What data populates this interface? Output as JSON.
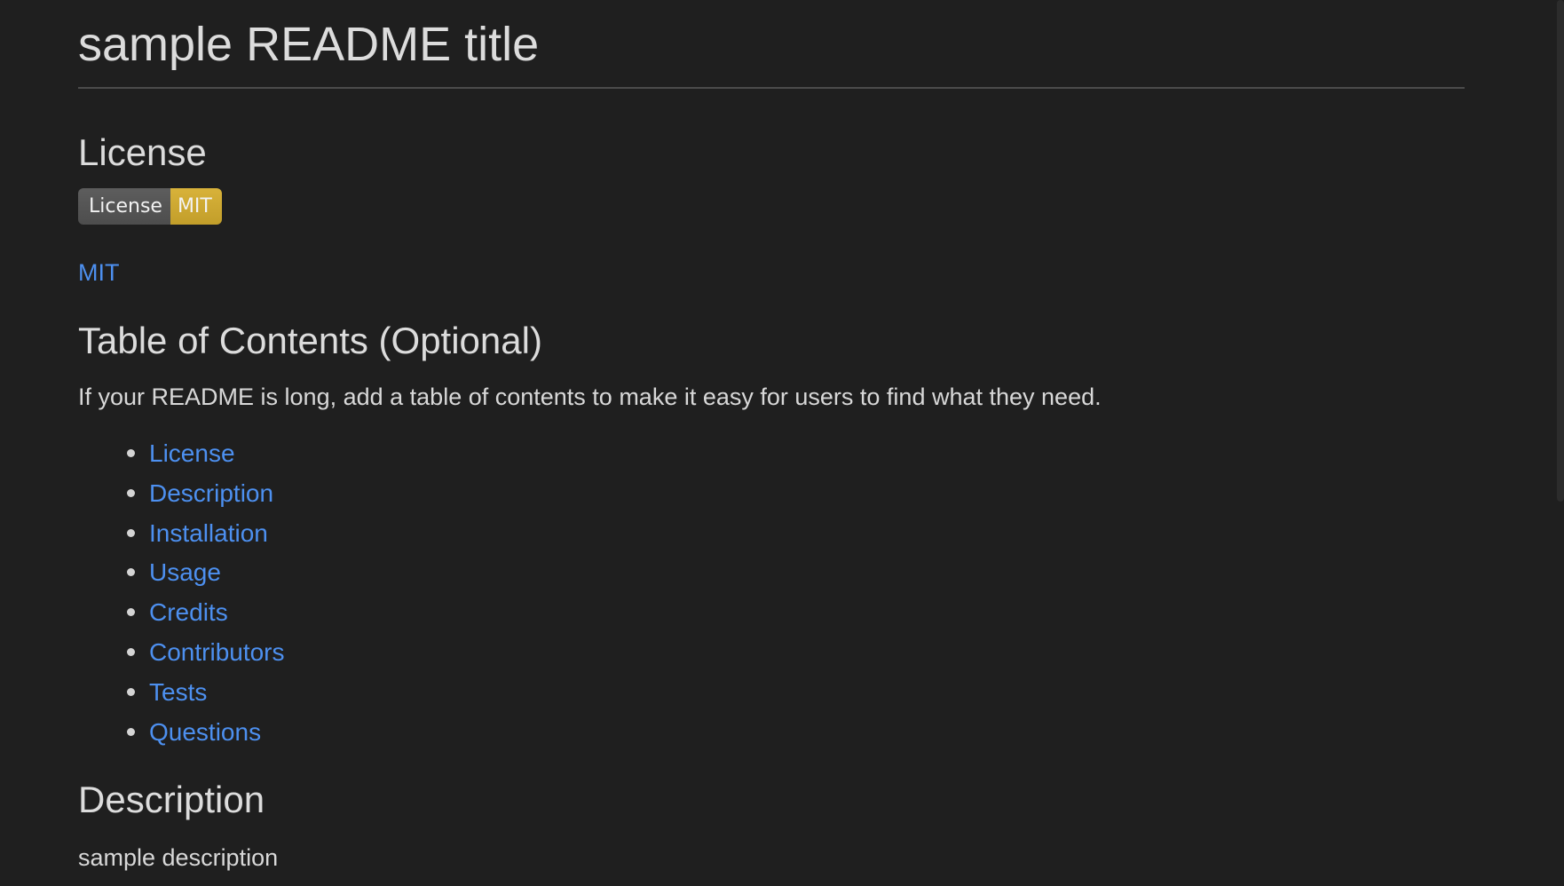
{
  "title": "sample README title",
  "license_section": {
    "heading": "License",
    "badge": {
      "label": "License",
      "value": "MIT",
      "value_color": "#c9a431"
    },
    "link_text": "MIT"
  },
  "toc_section": {
    "heading": "Table of Contents (Optional)",
    "intro": "If your README is long, add a table of contents to make it easy for users to find what they need.",
    "items": [
      {
        "label": "License"
      },
      {
        "label": "Description"
      },
      {
        "label": "Installation"
      },
      {
        "label": "Usage"
      },
      {
        "label": "Credits"
      },
      {
        "label": "Contributors"
      },
      {
        "label": "Tests"
      },
      {
        "label": "Questions"
      }
    ]
  },
  "description_section": {
    "heading": "Description",
    "text": "sample description"
  },
  "colors": {
    "background": "#1f1f1f",
    "text": "#d4d4d4",
    "link": "#4d90f0"
  }
}
